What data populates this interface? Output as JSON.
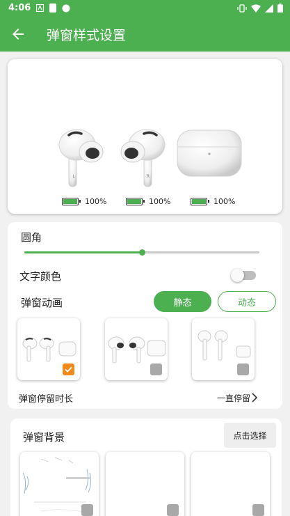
{
  "status_bar": {
    "time": "4:06"
  },
  "app_bar": {
    "title": "弹窗样式设置"
  },
  "preview": {
    "battery": [
      {
        "label": "100%",
        "level": 100
      },
      {
        "label": "100%",
        "level": 100
      },
      {
        "label": "100%",
        "level": 100
      }
    ],
    "left_mark": "L",
    "right_mark": "R"
  },
  "settings": {
    "corner_label": "圆角",
    "corner_value": 0.5,
    "text_color_label": "文字颜色",
    "text_color_enabled": false,
    "animation_label": "弹窗动画",
    "animation_static": "静态",
    "animation_dynamic": "动态",
    "selected_style_index": 0,
    "duration_label": "弹窗停留时长",
    "duration_value": "一直停留"
  },
  "background": {
    "label": "弹窗背景",
    "choose_button": "点击选择"
  },
  "colors": {
    "primary": "#4caf50",
    "selected_check": "#f08a1c",
    "unselected_check": "#a8a8a8"
  },
  "icons": [
    "back-arrow-icon",
    "chevron-right-icon",
    "check-icon",
    "wifi-icon",
    "signal-icon",
    "battery-icon",
    "vibrate-icon"
  ]
}
